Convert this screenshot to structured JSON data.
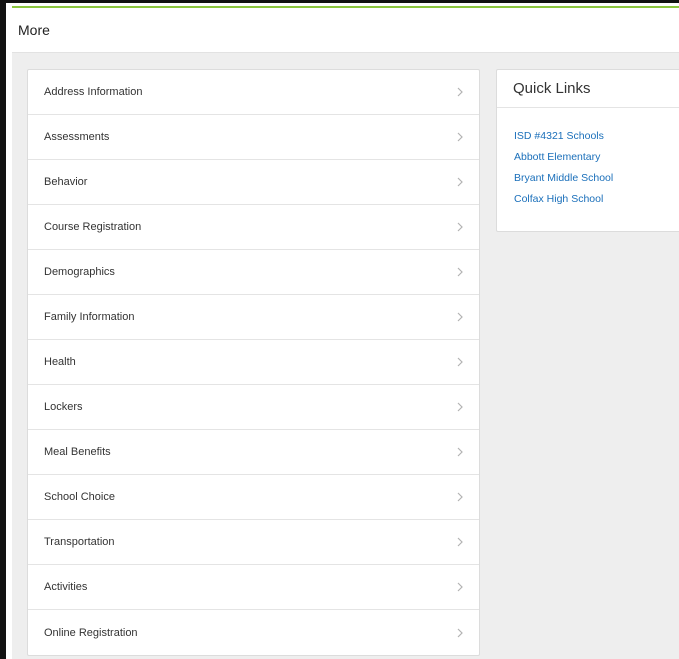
{
  "header": {
    "title": "More"
  },
  "menu": {
    "items": [
      {
        "label": "Address Information"
      },
      {
        "label": "Assessments"
      },
      {
        "label": "Behavior"
      },
      {
        "label": "Course Registration"
      },
      {
        "label": "Demographics"
      },
      {
        "label": "Family Information"
      },
      {
        "label": "Health"
      },
      {
        "label": "Lockers"
      },
      {
        "label": "Meal Benefits"
      },
      {
        "label": "School Choice"
      },
      {
        "label": "Transportation"
      },
      {
        "label": "Activities"
      },
      {
        "label": "Online Registration"
      }
    ],
    "chevron_icon": "chevron-right-icon"
  },
  "quick_links": {
    "title": "Quick Links",
    "links": [
      {
        "label": "ISD #4321 Schools"
      },
      {
        "label": "Abbott Elementary"
      },
      {
        "label": "Bryant Middle School"
      },
      {
        "label": "Colfax High School"
      }
    ]
  },
  "colors": {
    "accent": "#8cc63f",
    "link": "#1a6fba",
    "background": "#eeeeee"
  }
}
